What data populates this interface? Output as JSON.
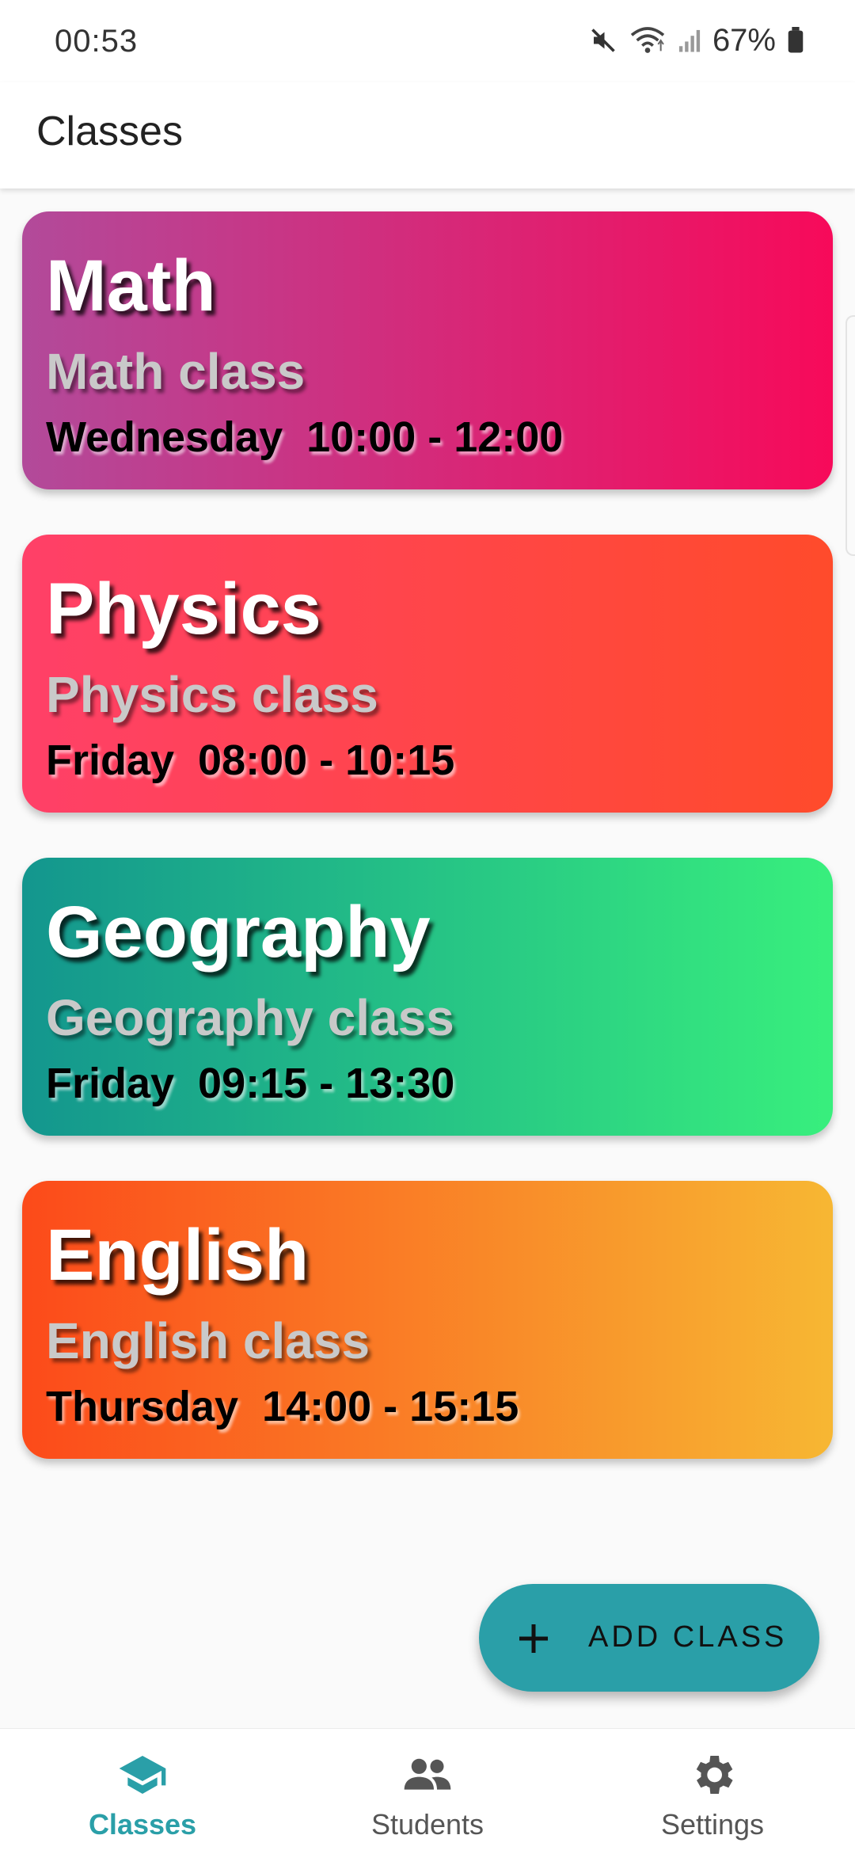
{
  "status_bar": {
    "time": "00:53",
    "battery": "67%",
    "icons": [
      "mute-icon",
      "wifi-icon",
      "signal-icon",
      "battery-icon"
    ]
  },
  "app_bar": {
    "title": "Classes"
  },
  "classes": [
    {
      "name": "Math",
      "description": "Math class",
      "schedule": "Wednesday  10:00 - 12:00",
      "gradient": [
        "#b24a9a",
        "#f70a5a"
      ]
    },
    {
      "name": "Physics",
      "description": "Physics class",
      "schedule": "Friday  08:00 - 10:15",
      "gradient": [
        "#ff4068",
        "#ff4b2b"
      ]
    },
    {
      "name": "Geography",
      "description": "Geography class",
      "schedule": "Friday  09:15 - 13:30",
      "gradient": [
        "#13968e",
        "#38ef7d"
      ]
    },
    {
      "name": "English",
      "description": "English class",
      "schedule": "Thursday  14:00 - 15:15",
      "gradient": [
        "#fc4a1a",
        "#f7b733"
      ]
    }
  ],
  "fab": {
    "label": "ADD CLASS",
    "icon": "plus-icon",
    "color": "#2a9fa8"
  },
  "bottom_nav": {
    "items": [
      {
        "label": "Classes",
        "icon": "graduation-cap-icon",
        "active": true
      },
      {
        "label": "Students",
        "icon": "people-icon",
        "active": false
      },
      {
        "label": "Settings",
        "icon": "gear-icon",
        "active": false
      }
    ],
    "active_color": "#2a9fa8"
  }
}
